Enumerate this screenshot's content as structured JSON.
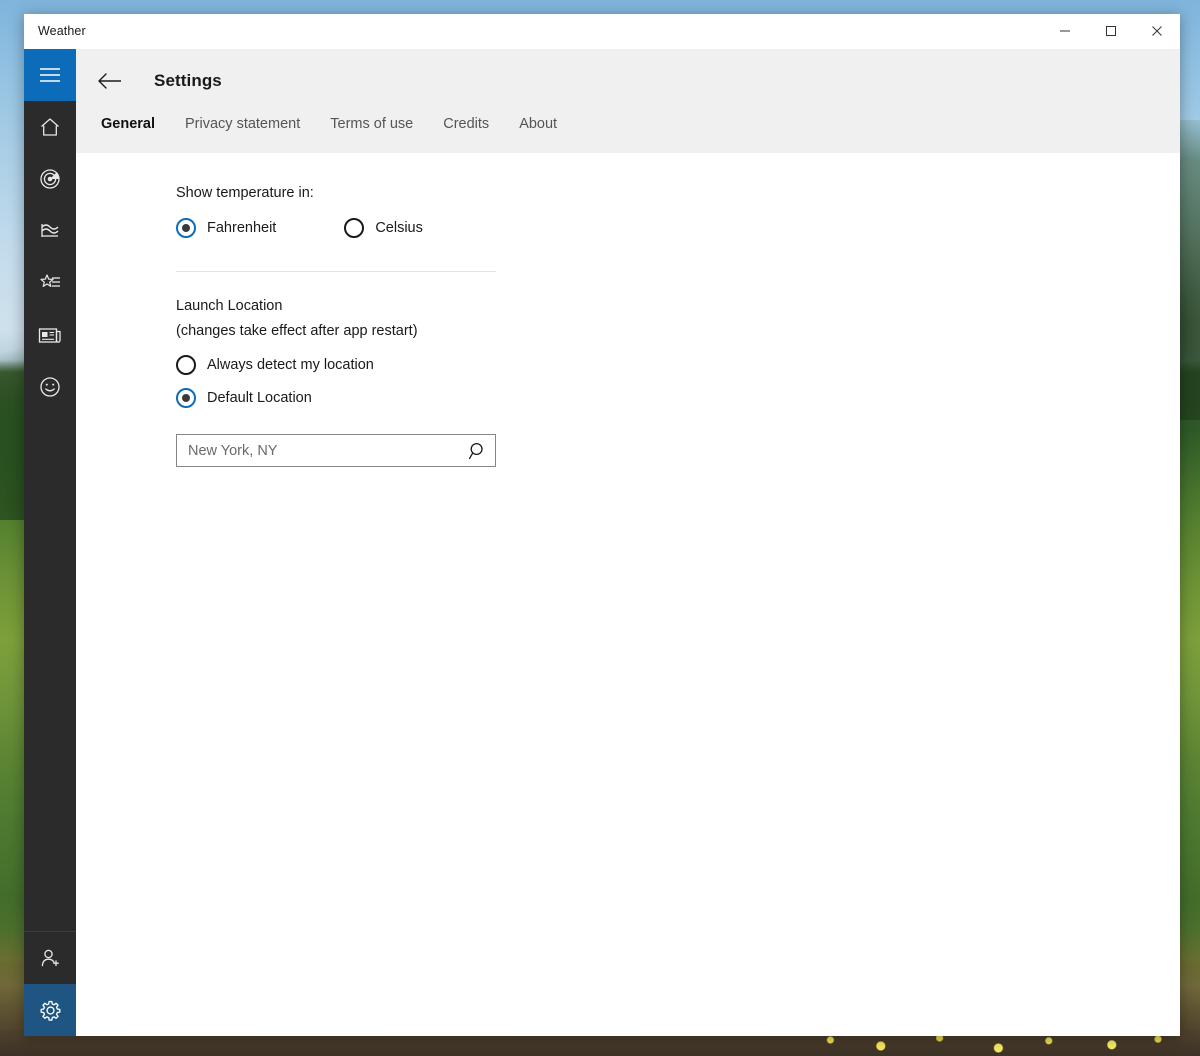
{
  "window": {
    "app_title": "Weather",
    "controls": {
      "minimize": "minimize-icon",
      "maximize": "maximize-icon",
      "close": "close-icon"
    }
  },
  "sidebar": {
    "accent_color": "#0c6cb9",
    "background_color": "#2b2b2b",
    "top_items": [
      {
        "icon": "hamburger-menu-icon",
        "name": "navigation-menu",
        "state": "accent"
      },
      {
        "icon": "home-icon",
        "name": "forecast",
        "state": "normal"
      },
      {
        "icon": "radar-icon",
        "name": "maps",
        "state": "normal"
      },
      {
        "icon": "historical-weather-icon",
        "name": "historical-weather",
        "state": "normal"
      },
      {
        "icon": "favorites-star-list-icon",
        "name": "favorites",
        "state": "normal"
      },
      {
        "icon": "news-icon",
        "name": "news",
        "state": "normal"
      },
      {
        "icon": "smiley-feedback-icon",
        "name": "send-feedback",
        "state": "normal"
      }
    ],
    "bottom_items": [
      {
        "icon": "add-person-icon",
        "name": "accounts",
        "state": "normal"
      },
      {
        "icon": "gear-icon",
        "name": "settings",
        "state": "accent-dim"
      }
    ]
  },
  "header": {
    "back_icon": "back-arrow-icon",
    "title": "Settings",
    "tabs": [
      {
        "label": "General",
        "active": true
      },
      {
        "label": "Privacy statement",
        "active": false
      },
      {
        "label": "Terms of use",
        "active": false
      },
      {
        "label": "Credits",
        "active": false
      },
      {
        "label": "About",
        "active": false
      }
    ]
  },
  "settings": {
    "temperature": {
      "label": "Show temperature in:",
      "options": [
        {
          "label": "Fahrenheit",
          "selected": true
        },
        {
          "label": "Celsius",
          "selected": false
        }
      ]
    },
    "launch_location": {
      "title": "Launch Location",
      "note": "(changes take effect after app restart)",
      "options": [
        {
          "label": "Always detect my location",
          "selected": false
        },
        {
          "label": "Default Location",
          "selected": true
        }
      ],
      "search": {
        "value": "",
        "placeholder": "New York, NY",
        "icon": "search-icon"
      }
    }
  }
}
